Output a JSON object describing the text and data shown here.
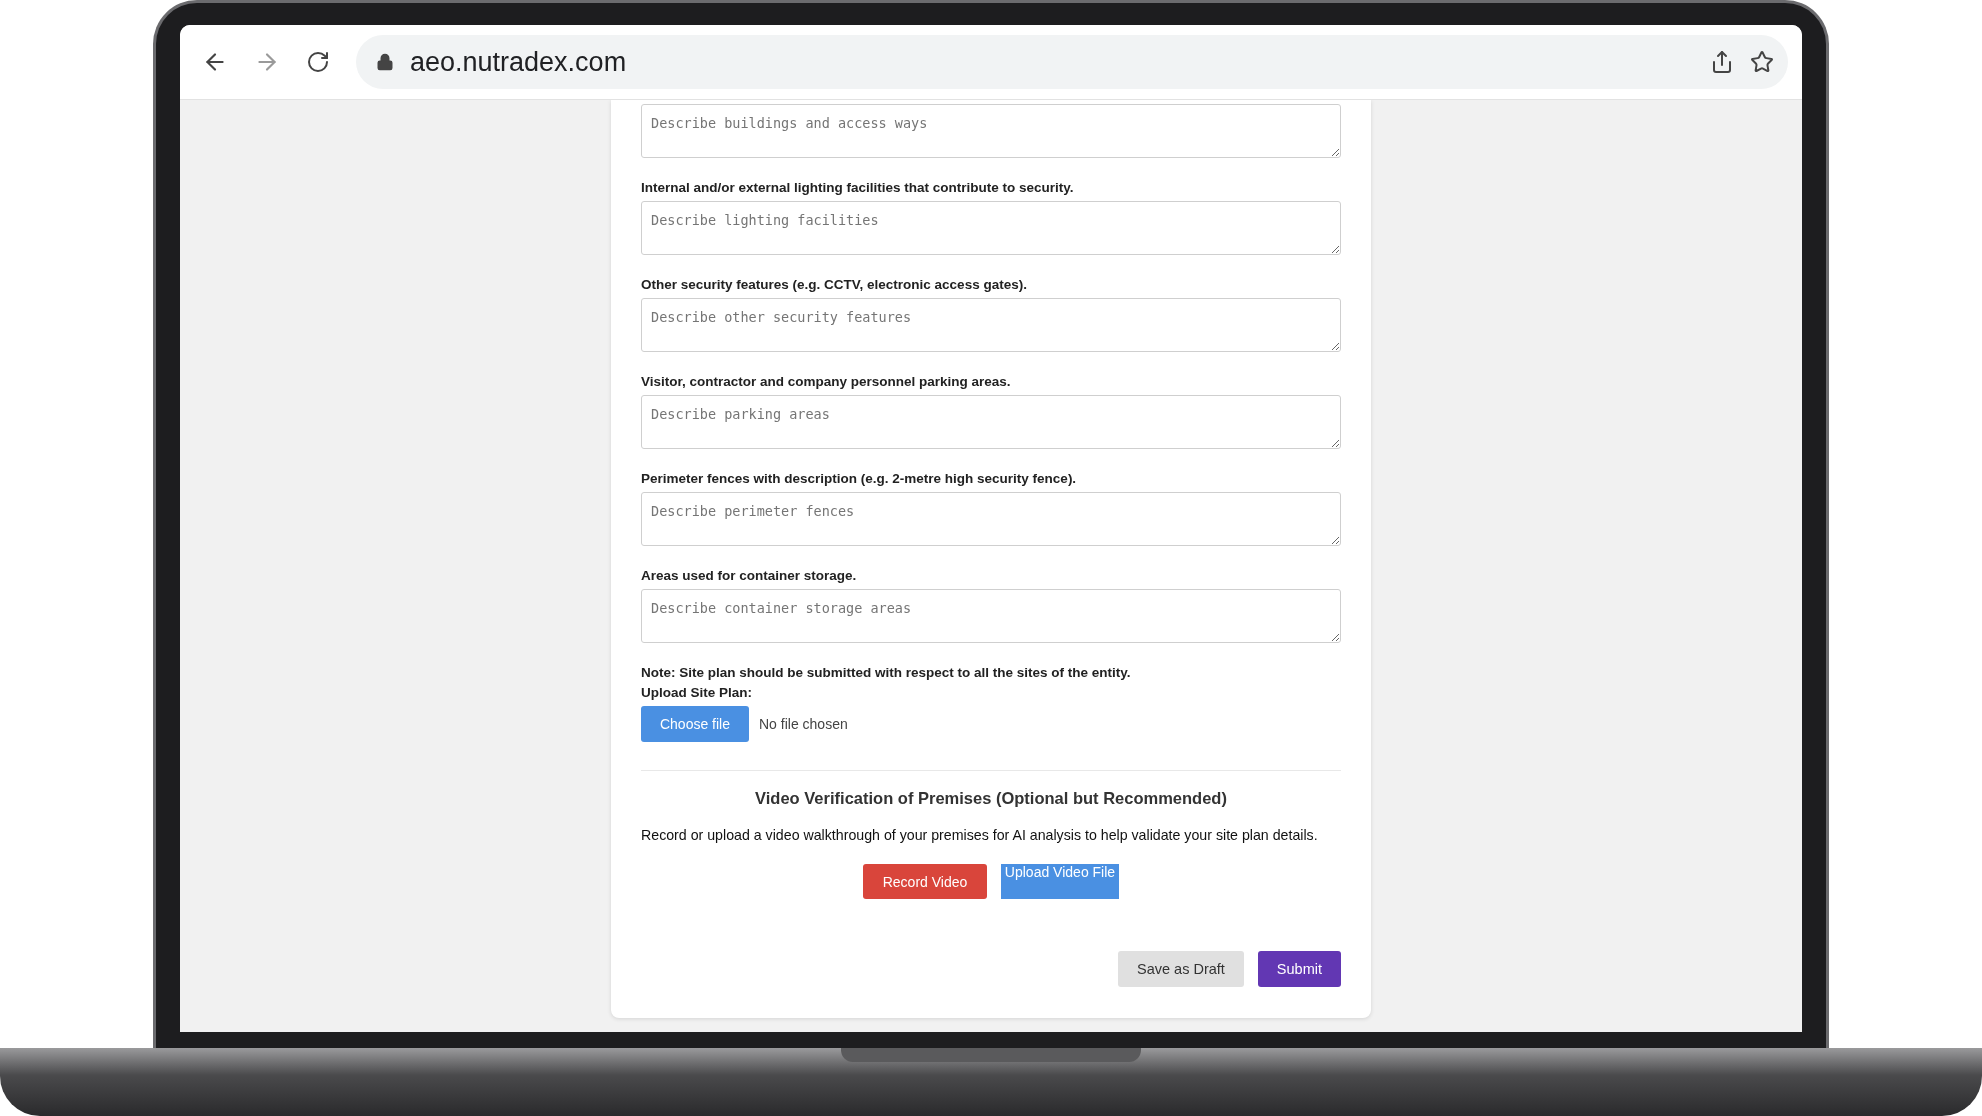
{
  "browser": {
    "url": "aeo.nutradex.com"
  },
  "fields": [
    {
      "placeholder": "Describe buildings and access ways"
    },
    {
      "label": "Internal and/or external lighting facilities that contribute to security.",
      "placeholder": "Describe lighting facilities"
    },
    {
      "label": "Other security features (e.g. CCTV, electronic access gates).",
      "placeholder": "Describe other security features"
    },
    {
      "label": "Visitor, contractor and company personnel parking areas.",
      "placeholder": "Describe parking areas"
    },
    {
      "label": "Perimeter fences with description (e.g. 2-metre high security fence).",
      "placeholder": "Describe perimeter fences"
    },
    {
      "label": "Areas used for container storage.",
      "placeholder": "Describe container storage areas"
    }
  ],
  "upload": {
    "note": "Note: Site plan should be submitted with respect to all the sites of the entity.",
    "label": "Upload Site Plan:",
    "button": "Choose file",
    "status": "No file chosen"
  },
  "video": {
    "heading": "Video Verification of Premises (Optional but Recommended)",
    "description": "Record or upload a video walkthrough of your premises for AI analysis to help validate your site plan details.",
    "buttons": [
      {
        "label": "Record Video",
        "kind": "record"
      },
      {
        "label": "Upload Video File",
        "kind": "upload"
      }
    ]
  },
  "actions": [
    {
      "label": "Save as Draft",
      "kind": "secondary"
    },
    {
      "label": "Submit",
      "kind": "primary"
    }
  ]
}
